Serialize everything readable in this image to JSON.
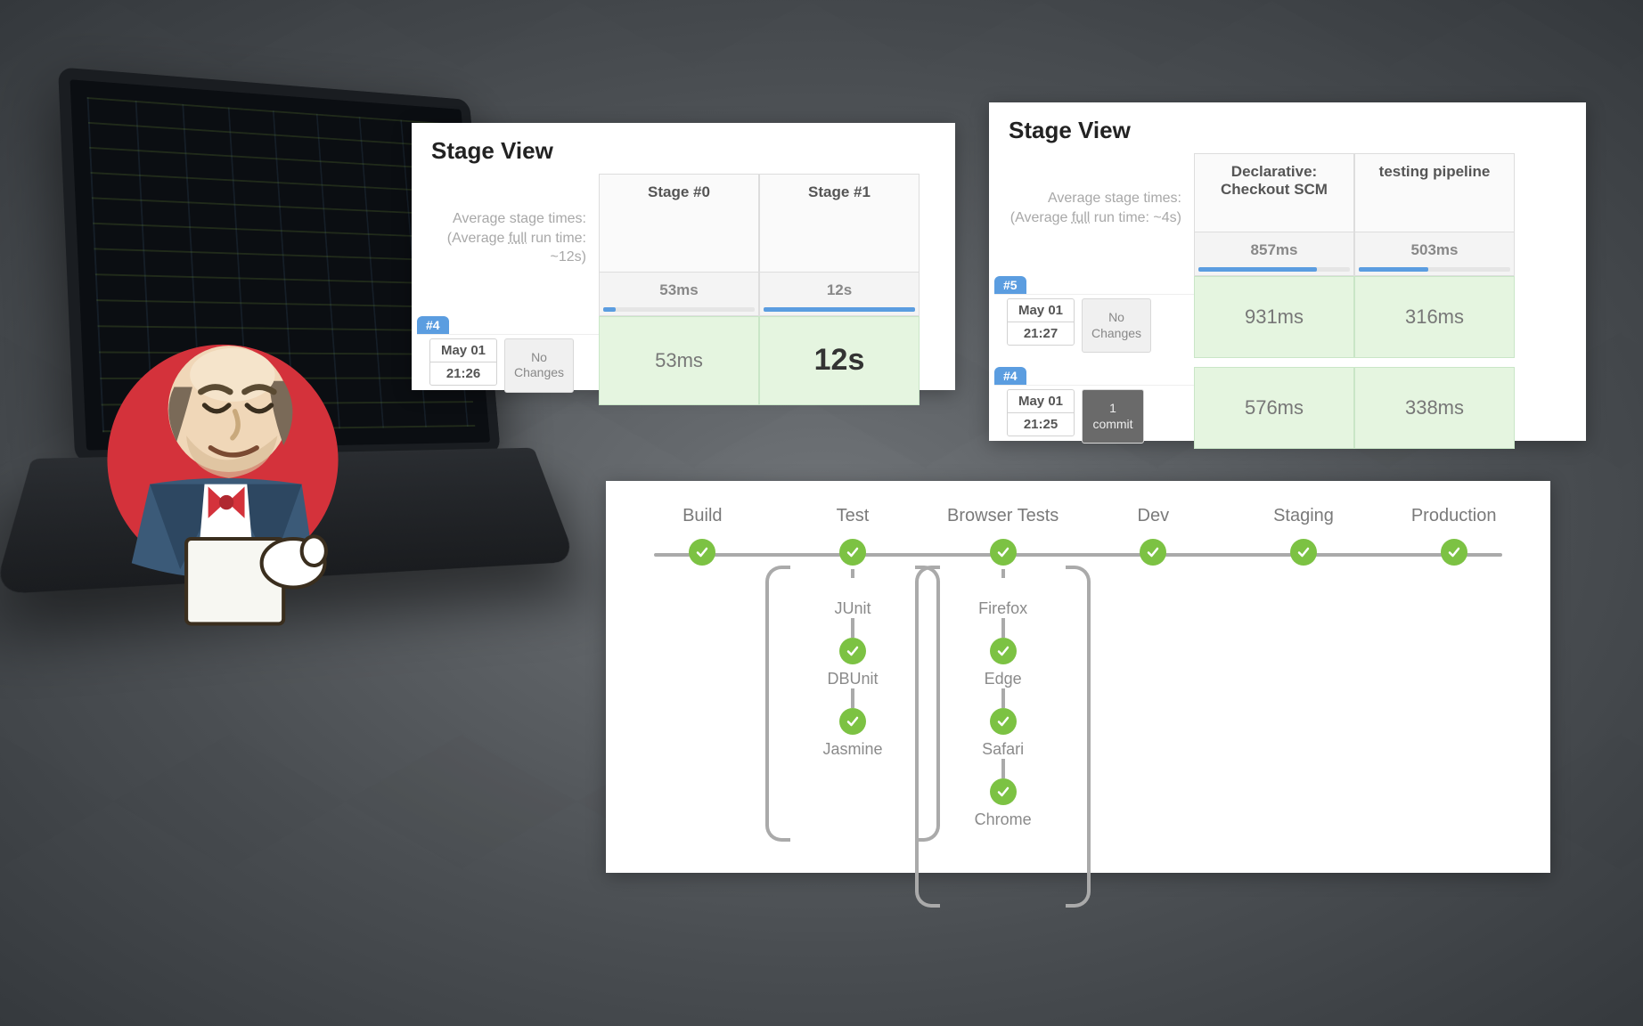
{
  "panel1": {
    "title": "Stage View",
    "avg_label1": "Average stage times:",
    "avg_label2_pre": "(Average ",
    "avg_label2_full": "full",
    "avg_label2_post": " run time: ~12s)",
    "cols": [
      {
        "name": "Stage #0",
        "avg": "53ms",
        "bar_pct": 8
      },
      {
        "name": "Stage #1",
        "avg": "12s",
        "bar_pct": 100
      }
    ],
    "runs": [
      {
        "build": "#4",
        "date": "May 01",
        "time": "21:26",
        "changes": "No\nChanges",
        "cells": [
          "53ms",
          "12s"
        ]
      }
    ]
  },
  "panel2": {
    "title": "Stage View",
    "avg_label1": "Average stage times:",
    "avg_label2_pre": "(Average ",
    "avg_label2_full": "full",
    "avg_label2_post": " run time: ~4s)",
    "cols": [
      {
        "name": "Declarative: Checkout SCM",
        "avg": "857ms",
        "bar_pct": 78
      },
      {
        "name": "testing pipeline",
        "avg": "503ms",
        "bar_pct": 46
      }
    ],
    "runs": [
      {
        "build": "#5",
        "date": "May 01",
        "time": "21:27",
        "changes": "No\nChanges",
        "changes_kind": "none",
        "cells": [
          "931ms",
          "316ms"
        ]
      },
      {
        "build": "#4",
        "date": "May 01",
        "time": "21:25",
        "changes": "1\ncommit",
        "changes_kind": "commit",
        "cells": [
          "576ms",
          "338ms"
        ]
      }
    ]
  },
  "pipeline": {
    "stages": [
      "Build",
      "Test",
      "Browser Tests",
      "Dev",
      "Staging",
      "Production"
    ],
    "subtrees": {
      "Test": [
        "JUnit",
        "DBUnit",
        "Jasmine"
      ],
      "Browser Tests": [
        "Firefox",
        "Edge",
        "Safari",
        "Chrome"
      ]
    }
  },
  "colors": {
    "success": "#7cc243",
    "bar": "#5b9de0"
  }
}
